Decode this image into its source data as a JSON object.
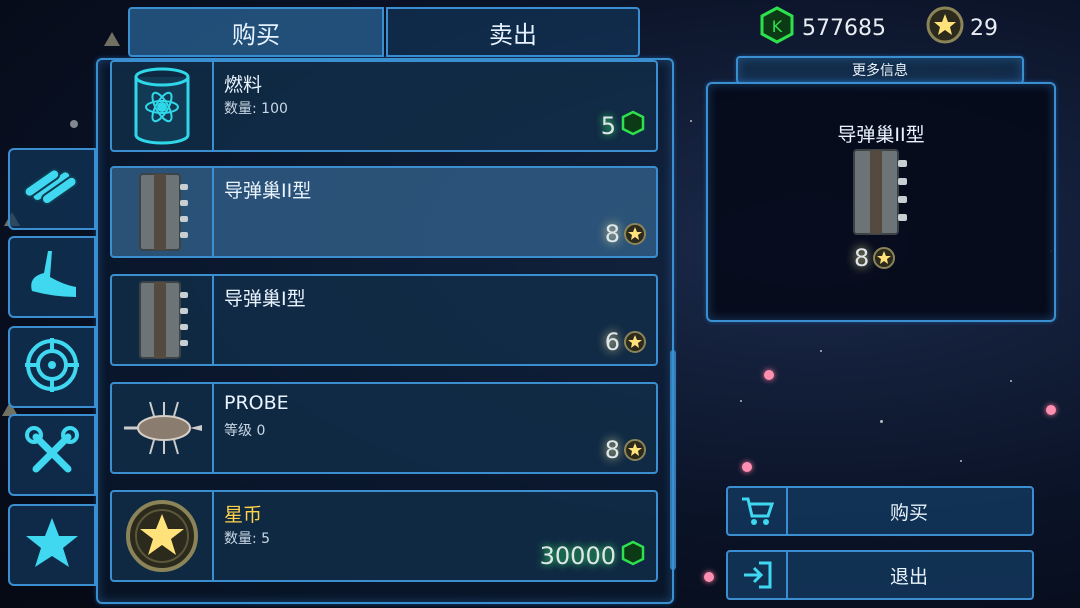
{
  "tabs": {
    "buy": "购买",
    "sell": "卖出"
  },
  "currency": {
    "gems": "577685",
    "stars": "29"
  },
  "detail": {
    "more_info": "更多信息",
    "title": "导弹巢II型",
    "price": "8"
  },
  "actions": {
    "buy": "购买",
    "exit": "退出"
  },
  "items": [
    {
      "name": "燃料",
      "sub": "数量: 100",
      "price": "5",
      "currency_icon": "gem-icon"
    },
    {
      "name": "导弹巢II型",
      "sub": "",
      "price": "8",
      "currency_icon": "star-coin-icon"
    },
    {
      "name": "导弹巢I型",
      "sub": "",
      "price": "6",
      "currency_icon": "star-coin-icon"
    },
    {
      "name": "PROBE",
      "sub": "等级 0",
      "price": "8",
      "currency_icon": "star-coin-icon"
    },
    {
      "name": "星币",
      "sub": "数量: 5",
      "price": "30000",
      "currency_icon": "gem-icon"
    }
  ],
  "side_tabs": [
    "materials-icon",
    "hull-icon",
    "target-icon",
    "tools-icon",
    "star-icon"
  ],
  "colors": {
    "accent": "#3a8fd0",
    "gem_green": "#2fe04e",
    "gold": "#ffd24a"
  }
}
